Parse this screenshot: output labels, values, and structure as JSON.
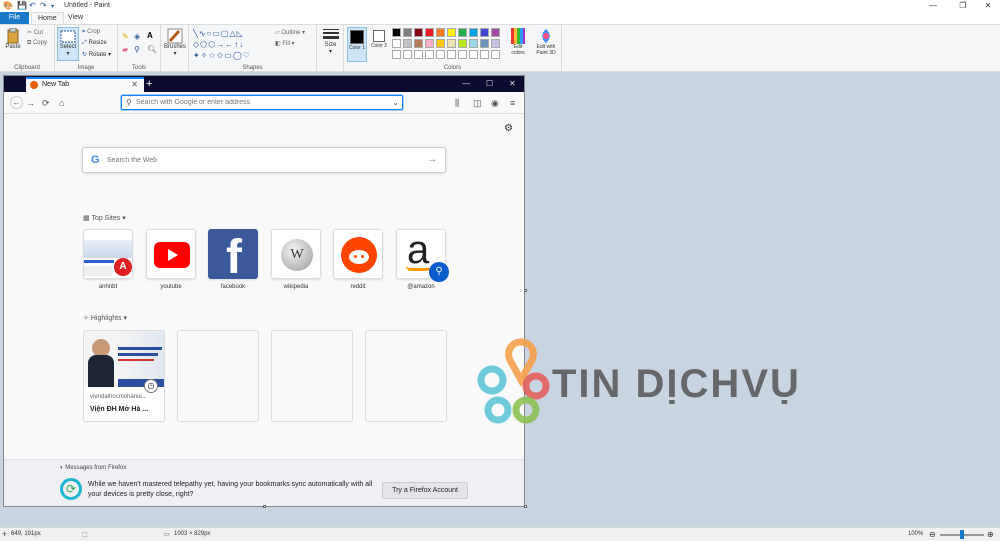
{
  "app": {
    "window_title": "Untitled - Paint",
    "colors": {
      "file_tab": "#1979ca",
      "ribbon_bg": "#f5f6f7",
      "canvas_bg": "#c9d4e3"
    }
  },
  "ribbon": {
    "tabs": [
      {
        "label": "File"
      },
      {
        "label": "Home"
      },
      {
        "label": "View"
      }
    ],
    "clipboard": {
      "paste": "Paste",
      "cut": "Cut",
      "copy": "Copy",
      "label": "Clipboard"
    },
    "image": {
      "select": "Select",
      "crop": "Crop",
      "resize": "Resize",
      "rotate": "Rotate",
      "label": "Image"
    },
    "tools": {
      "label": "Tools",
      "brushes": "Brushes"
    },
    "shapes": {
      "outline": "Outline",
      "fill": "Fill",
      "label": "Shapes",
      "size": "Size"
    },
    "colors": {
      "color1": "Color 1",
      "color2": "Color 2",
      "label": "Colors",
      "edit_colors": "Edit colors",
      "paint3d": "Edit with Paint 3D",
      "color1_value": "#000000",
      "color2_value": "#ffffff",
      "palette": [
        "#000000",
        "#7f7f7f",
        "#880015",
        "#ed1c24",
        "#ff7f27",
        "#fff200",
        "#22b14c",
        "#00a2e8",
        "#3f48cc",
        "#a349a4",
        "#ffffff",
        "#c3c3c3",
        "#b97a57",
        "#ffaec9",
        "#ffc90e",
        "#efe4b0",
        "#b5e61d",
        "#99d9ea",
        "#7092be",
        "#c8bfe7"
      ]
    }
  },
  "browser": {
    "tab_title": "New Tab",
    "url_placeholder": "Search with Google or enter address",
    "search_placeholder": "Search the Web",
    "top_sites_title": "Top Sites",
    "top_sites": [
      {
        "label": "anhnbt"
      },
      {
        "label": "youtube"
      },
      {
        "label": "facebook"
      },
      {
        "label": "wikipedia"
      },
      {
        "label": "reddit"
      },
      {
        "label": "@amazon"
      }
    ],
    "highlights_title": "Highlights",
    "highlight": {
      "source": "viendaihocmohanoi...",
      "title": "Viện ĐH Mở Hà ..."
    },
    "message": {
      "header": "Messages from Firefox",
      "body": "While we haven't mastered telepathy yet, having your bookmarks sync automatically with all your devices is pretty close, right?",
      "button": "Try a Firefox Account"
    }
  },
  "watermark": {
    "text": "TIN DỊCHVỤ"
  },
  "status": {
    "cursor_pos": "649, 191px",
    "canvas_size": "1003 × 829px",
    "zoom": "100%"
  }
}
